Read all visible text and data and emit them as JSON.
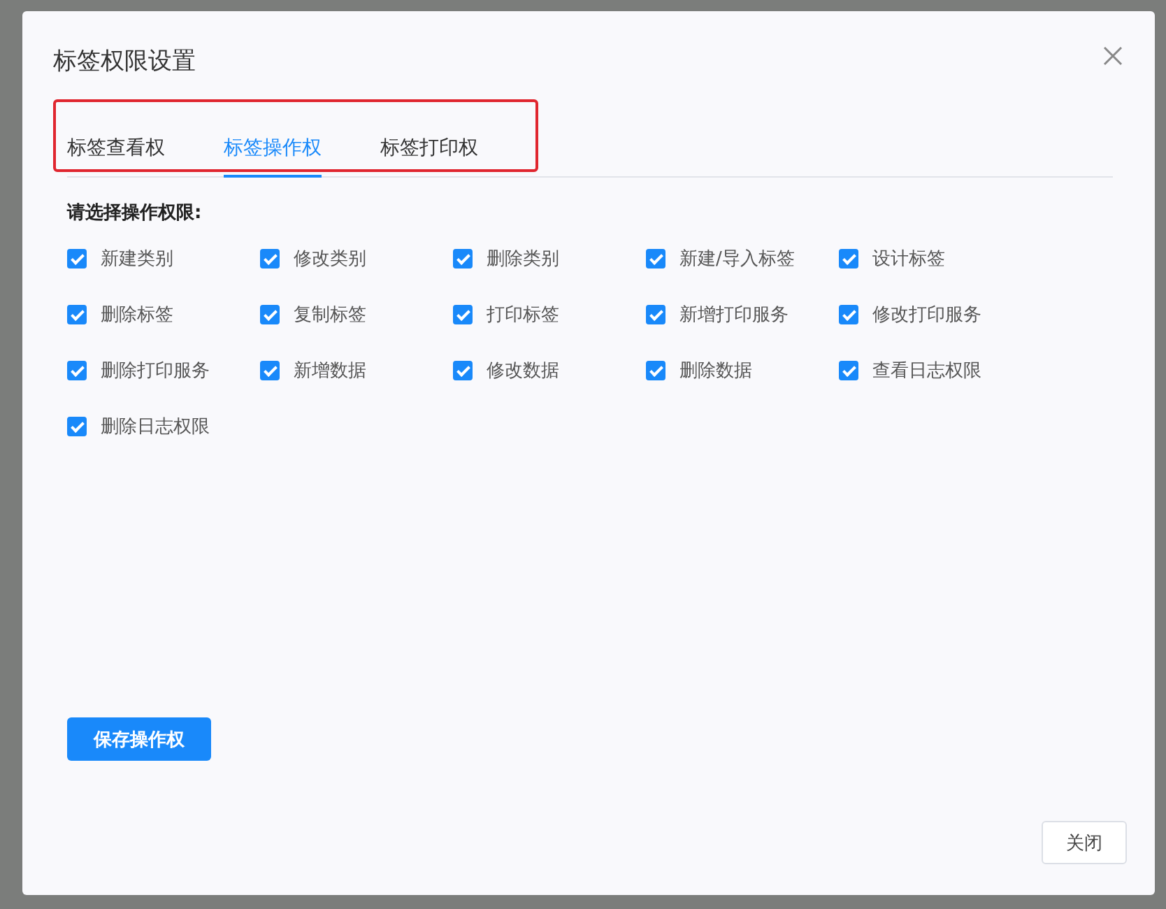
{
  "dialog": {
    "title": "标签权限设置",
    "tabs": [
      {
        "label": "标签查看权",
        "selected": false
      },
      {
        "label": "标签操作权",
        "selected": true
      },
      {
        "label": "标签打印权",
        "selected": false
      }
    ],
    "heading": "请选择操作权限:",
    "permissions": [
      {
        "label": "新建类别",
        "checked": true
      },
      {
        "label": "修改类别",
        "checked": true
      },
      {
        "label": "删除类别",
        "checked": true
      },
      {
        "label": "新建/导入标签",
        "checked": true
      },
      {
        "label": "设计标签",
        "checked": true
      },
      {
        "label": "删除标签",
        "checked": true
      },
      {
        "label": "复制标签",
        "checked": true
      },
      {
        "label": "打印标签",
        "checked": true
      },
      {
        "label": "新增打印服务",
        "checked": true
      },
      {
        "label": "修改打印服务",
        "checked": true
      },
      {
        "label": "删除打印服务",
        "checked": true
      },
      {
        "label": "新增数据",
        "checked": true
      },
      {
        "label": "修改数据",
        "checked": true
      },
      {
        "label": "删除数据",
        "checked": true
      },
      {
        "label": "查看日志权限",
        "checked": true
      },
      {
        "label": "删除日志权限",
        "checked": true
      }
    ],
    "save_button": "保存操作权",
    "close_button": "关闭"
  }
}
